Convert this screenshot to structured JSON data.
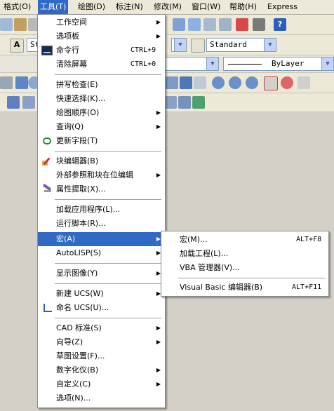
{
  "menubar": {
    "items": [
      "格式(O)",
      "工具(T)",
      "绘图(D)",
      "标注(N)",
      "修改(M)",
      "窗口(W)",
      "帮助(H)",
      "Express"
    ]
  },
  "toolbars": {
    "text_style_partial": "St",
    "dim_style": "Standard",
    "linetype": "ByLayer"
  },
  "tools_menu": {
    "items": [
      {
        "label": "工作空间",
        "shortcut": "",
        "submenu": true
      },
      {
        "label": "选项板",
        "shortcut": "",
        "submenu": true
      },
      {
        "label": "命令行",
        "shortcut": "CTRL+9",
        "submenu": false,
        "icon": "command-line-icon"
      },
      {
        "label": "清除屏幕",
        "shortcut": "CTRL+0",
        "submenu": false
      },
      {
        "label": "拼写检查(E)",
        "shortcut": "",
        "submenu": false
      },
      {
        "label": "快速选择(K)...",
        "shortcut": "",
        "submenu": false
      },
      {
        "label": "绘图顺序(O)",
        "shortcut": "",
        "submenu": true
      },
      {
        "label": "查询(Q)",
        "shortcut": "",
        "submenu": true
      },
      {
        "label": "更新字段(T)",
        "shortcut": "",
        "submenu": false,
        "icon": "update-field-icon"
      },
      {
        "label": "块编辑器(B)",
        "shortcut": "",
        "submenu": false,
        "icon": "block-editor-icon"
      },
      {
        "label": "外部参照和块在位编辑",
        "shortcut": "",
        "submenu": true
      },
      {
        "label": "属性提取(X)...",
        "shortcut": "",
        "submenu": false,
        "icon": "attribute-extract-icon"
      },
      {
        "label": "加载应用程序(L)...",
        "shortcut": "",
        "submenu": false
      },
      {
        "label": "运行脚本(R)...",
        "shortcut": "",
        "submenu": false
      },
      {
        "label": "宏(A)",
        "shortcut": "",
        "submenu": true,
        "highlighted": true
      },
      {
        "label": "AutoLISP(S)",
        "shortcut": "",
        "submenu": true
      },
      {
        "label": "显示图像(Y)",
        "shortcut": "",
        "submenu": true
      },
      {
        "label": "新建 UCS(W)",
        "shortcut": "",
        "submenu": true
      },
      {
        "label": "命名 UCS(U)...",
        "shortcut": "",
        "submenu": false,
        "icon": "named-ucs-icon"
      },
      {
        "label": "CAD 标准(S)",
        "shortcut": "",
        "submenu": true
      },
      {
        "label": "向导(Z)",
        "shortcut": "",
        "submenu": true
      },
      {
        "label": "草图设置(F)...",
        "shortcut": "",
        "submenu": false
      },
      {
        "label": "数字化仪(B)",
        "shortcut": "",
        "submenu": true
      },
      {
        "label": "自定义(C)",
        "shortcut": "",
        "submenu": true
      },
      {
        "label": "选项(N)...",
        "shortcut": "",
        "submenu": false
      }
    ]
  },
  "macro_menu": {
    "items": [
      {
        "label": "宏(M)...",
        "shortcut": "ALT+F8"
      },
      {
        "label": "加载工程(L)...",
        "shortcut": ""
      },
      {
        "label": "VBA 管理器(V)...",
        "shortcut": ""
      },
      {
        "label": "Visual Basic 编辑器(B)",
        "shortcut": "ALT+F11"
      }
    ]
  },
  "colors": {
    "highlight": "#316ac5",
    "menubar": "#ece9d8"
  }
}
